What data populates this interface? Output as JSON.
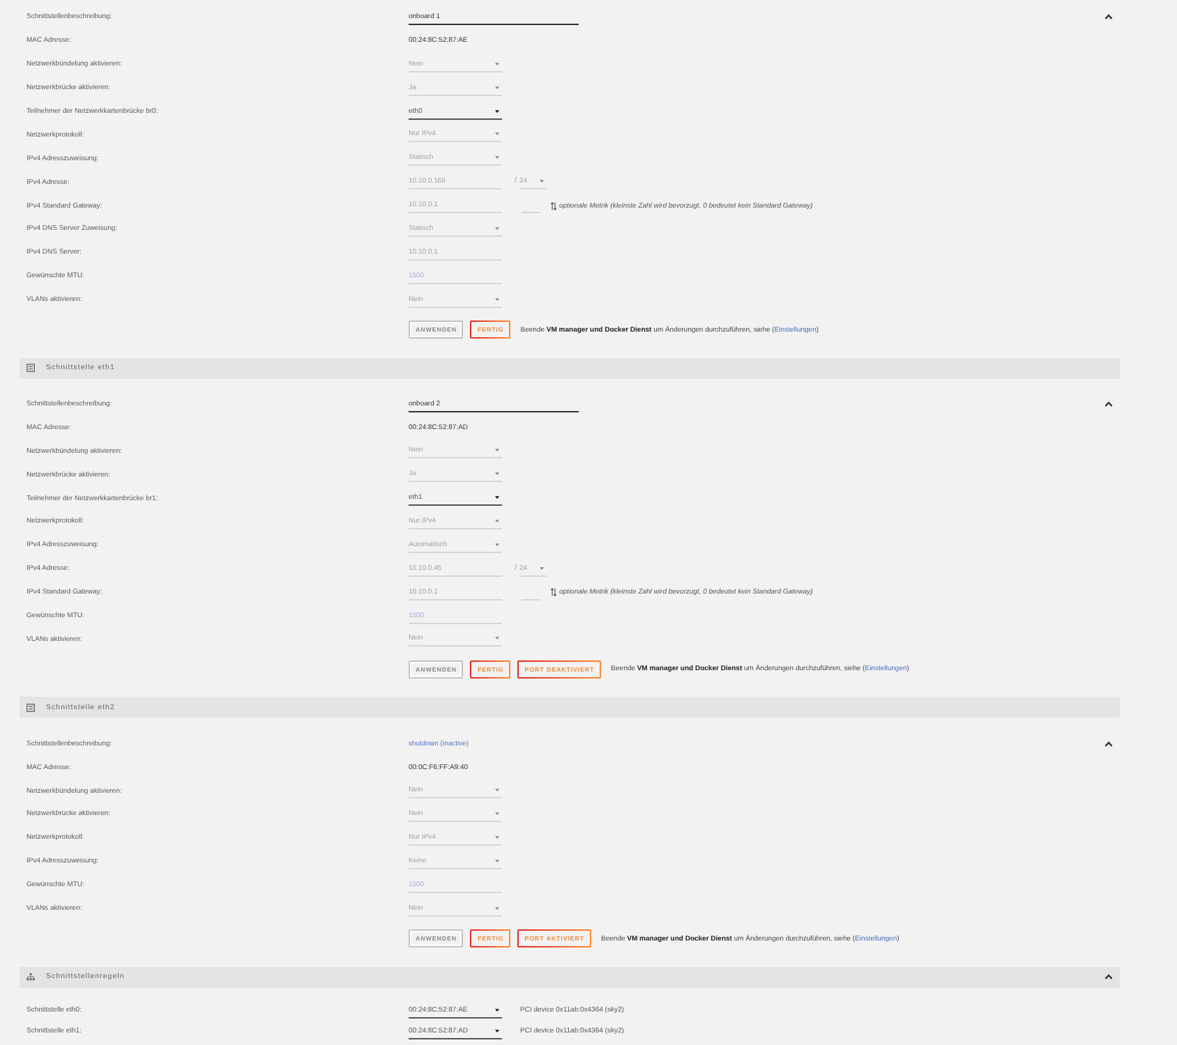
{
  "sections": [
    {
      "kind": "interface",
      "expanded": true,
      "rows": [
        {
          "label": "Schnittstellenbeschreibung:",
          "kind": "description",
          "value": "onboard 1",
          "disabled": false
        },
        {
          "label": "MAC Adresse:",
          "kind": "static",
          "value": "00:24:8C:52:87:AE"
        },
        {
          "label": "Netzwerkbündelung aktivieren:",
          "kind": "select",
          "value": "Nein",
          "disabled": true
        },
        {
          "label": "Netzwerkbrücke aktivieren:",
          "kind": "select",
          "value": "Ja",
          "disabled": true
        },
        {
          "label": "Teilnehmer der Netzwerkkartenbrücke br0:",
          "kind": "select",
          "value": "eth0",
          "disabled": false
        },
        {
          "label": "Netzwerkprotokoll:",
          "kind": "select",
          "value": "Nur IPv4",
          "disabled": true
        },
        {
          "label": "IPv4 Adresszuweisung:",
          "kind": "select",
          "value": "Statisch",
          "disabled": true
        },
        {
          "label": "IPv4 Adresse:",
          "kind": "address",
          "value": "10.10.0.168",
          "separator": "/",
          "prefix": "24",
          "disabled": true
        },
        {
          "label": "IPv4 Standard Gateway:",
          "kind": "gateway",
          "value": "10.10.0.1",
          "note": "optionale Metrik (kleinste Zahl wird bevorzugt, 0 bedeutet kein Standard Gateway)",
          "disabled": true
        },
        {
          "label": "IPv4 DNS Server Zuweisung:",
          "kind": "select",
          "value": "Statisch",
          "disabled": true
        },
        {
          "label": "IPv4 DNS Server:",
          "kind": "input",
          "value": "10.10.0.1",
          "disabled": true
        },
        {
          "label": "Gewünschte MTU:",
          "kind": "input",
          "placeholder": "1500",
          "disabled": true
        },
        {
          "label": "VLANs aktivieren:",
          "kind": "select",
          "value": "Nein",
          "disabled": true
        }
      ],
      "actions": {
        "buttons": [
          {
            "label": "ANWENDEN",
            "disabled": true
          },
          {
            "label": "FERTIG",
            "disabled": false
          }
        ],
        "note": {
          "text": "Beende **VM manager und Docker Dienst** um Änderungen durchzuführen, siehe (",
          "link": "Einstellungen",
          "after": ")"
        }
      }
    },
    {
      "kind": "interface",
      "title": "Schnittstelle eth1",
      "expanded": true,
      "rows": [
        {
          "label": "Schnittstellenbeschreibung:",
          "kind": "description",
          "value": "onboard 2",
          "disabled": false
        },
        {
          "label": "MAC Adresse:",
          "kind": "static",
          "value": "00:24:8C:52:87:AD"
        },
        {
          "label": "Netzwerkbündelung aktivieren:",
          "kind": "select",
          "value": "Nein",
          "disabled": true
        },
        {
          "label": "Netzwerkbrücke aktivieren:",
          "kind": "select",
          "value": "Ja",
          "disabled": true
        },
        {
          "label": "Teilnehmer der Netzwerkkartenbrücke br1:",
          "kind": "select",
          "value": "eth1",
          "disabled": false
        },
        {
          "label": "Netzwerkprotokoll:",
          "kind": "select",
          "value": "Nur IPv4",
          "disabled": true
        },
        {
          "label": "IPv4 Adresszuweisung:",
          "kind": "select",
          "value": "Automatisch",
          "disabled": true
        },
        {
          "label": "IPv4 Adresse:",
          "kind": "address",
          "value": "10.10.0.45",
          "separator": "/",
          "prefix": "24",
          "disabled": true
        },
        {
          "label": "IPv4 Standard Gateway:",
          "kind": "gateway",
          "value": "10.10.0.1",
          "note": "optionale Metrik (kleinste Zahl wird bevorzugt, 0 bedeutet kein Standard Gateway)",
          "disabled": true
        },
        {
          "label": "Gewünschte MTU:",
          "kind": "input",
          "placeholder": "1500",
          "disabled": true
        },
        {
          "label": "VLANs aktivieren:",
          "kind": "select",
          "value": "Nein",
          "disabled": true
        }
      ],
      "actions": {
        "buttons": [
          {
            "label": "ANWENDEN",
            "disabled": true
          },
          {
            "label": "FERTIG",
            "disabled": false
          },
          {
            "label": "PORT DEAKTIVIERT",
            "disabled": false
          }
        ],
        "note": {
          "text": "Beende **VM manager und Docker Dienst** um Änderungen durchzuführen, siehe (",
          "link": "Einstellungen",
          "after": ")"
        }
      }
    },
    {
      "kind": "interface",
      "title": "Schnittstelle eth2",
      "expanded": true,
      "rows": [
        {
          "label": "Schnittstellenbeschreibung:",
          "kind": "link",
          "value": "shutdown (inactive)"
        },
        {
          "label": "MAC Adresse:",
          "kind": "static",
          "value": "00:0C:F6:FF:A9:40"
        },
        {
          "label": "Netzwerkbündelung aktivieren:",
          "kind": "select",
          "value": "Nein",
          "disabled": true
        },
        {
          "label": "Netzwerkbrücke aktivieren:",
          "kind": "select",
          "value": "Nein",
          "disabled": true
        },
        {
          "label": "Netzwerkprotokoll:",
          "kind": "select",
          "value": "Nur IPv4",
          "disabled": true
        },
        {
          "label": "IPv4 Adresszuweisung:",
          "kind": "select",
          "value": "Keine",
          "disabled": true
        },
        {
          "label": "Gewünschte MTU:",
          "kind": "input",
          "placeholder": "1500",
          "disabled": true
        },
        {
          "label": "VLANs aktivieren:",
          "kind": "select",
          "value": "Nein",
          "disabled": true
        }
      ],
      "actions": {
        "buttons": [
          {
            "label": "ANWENDEN",
            "disabled": true
          },
          {
            "label": "FERTIG",
            "disabled": false
          },
          {
            "label": "PORT AKTIVIERT",
            "disabled": false
          }
        ],
        "note": {
          "text": "Beende **VM manager und Docker Dienst** um Änderungen durchzuführen, siehe (",
          "link": "Einstellungen",
          "after": ")"
        }
      }
    },
    {
      "kind": "rules",
      "title": "Schnittstellenregeln",
      "expanded": true,
      "rows": [
        {
          "label": "Schnittstelle eth0:",
          "kind": "rule",
          "value": "00:24:8C:52:87:AE",
          "note": "PCI device 0x11ab:0x4364 (sky2)",
          "disabled": false
        },
        {
          "label": "Schnittstelle eth1:",
          "kind": "rule",
          "value": "00:24:8C:52:87:AD",
          "note": "PCI device 0x11ab:0x4364 (sky2)",
          "disabled": false
        }
      ]
    }
  ]
}
